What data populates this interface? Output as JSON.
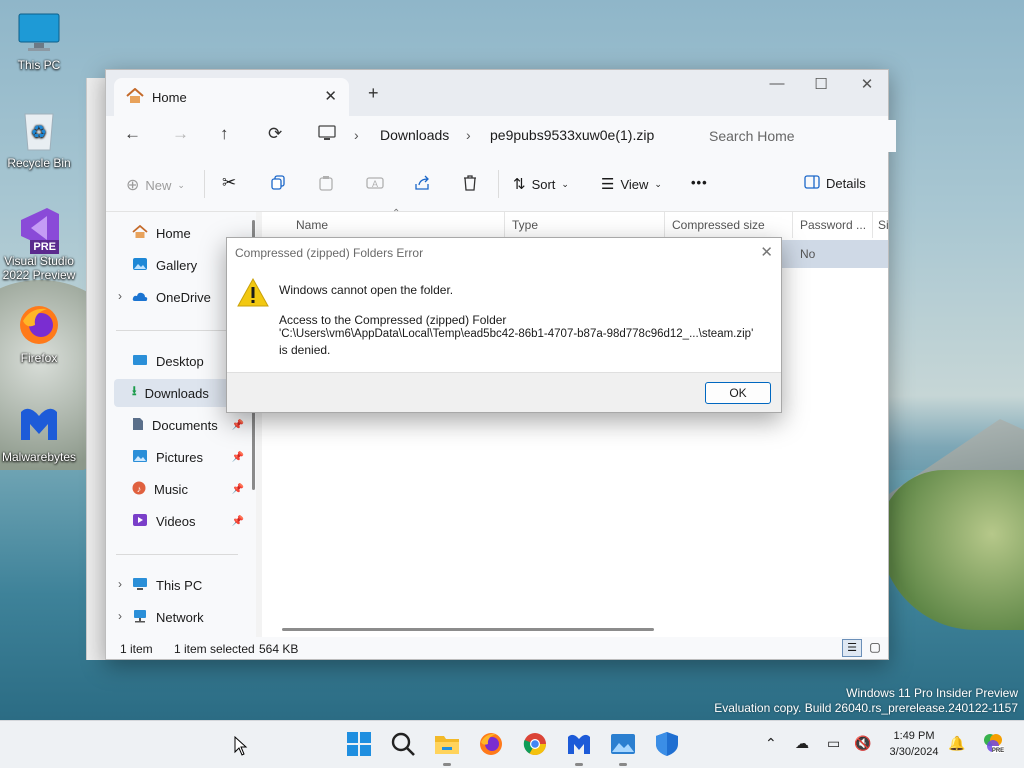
{
  "desktop": {
    "icons": [
      {
        "label": "This PC"
      },
      {
        "label": "Recycle Bin"
      },
      {
        "label": "Visual Studio 2022 Preview",
        "badge": "PRE"
      },
      {
        "label": "Firefox"
      },
      {
        "label": "Malwarebytes"
      }
    ],
    "watermark": {
      "line1": "Windows 11 Pro Insider Preview",
      "line2": "Evaluation copy. Build 26040.rs_prerelease.240122-1157"
    }
  },
  "explorer": {
    "tab_title": "Home",
    "breadcrumb": [
      "Downloads",
      "pe9pubs9533xuw0e(1).zip"
    ],
    "search_placeholder": "Search Home",
    "toolbar": {
      "new_label": "New",
      "sort_label": "Sort",
      "view_label": "View",
      "more_label": "•••",
      "details_label": "Details"
    },
    "sidebar": {
      "home": "Home",
      "gallery": "Gallery",
      "onedrive": "OneDrive",
      "desktop": "Desktop",
      "downloads": "Downloads",
      "documents": "Documents",
      "pictures": "Pictures",
      "music": "Music",
      "videos": "Videos",
      "thispc": "This PC",
      "network": "Network"
    },
    "columns": [
      "Name",
      "Type",
      "Compressed size",
      "Password ...",
      "Si"
    ],
    "row": {
      "password": "No"
    },
    "status": {
      "count": "1 item",
      "selected": "1 item selected",
      "size": "564 KB"
    }
  },
  "dialog": {
    "title": "Compressed (zipped) Folders Error",
    "message": "Windows cannot open the folder.",
    "detail1": "Access to the Compressed (zipped) Folder",
    "detail2": "'C:\\Users\\vm6\\AppData\\Local\\Temp\\ead5bc42-86b1-4707-b87a-98d778c96d12_...\\steam.zip'",
    "detail3": "is denied.",
    "ok_label": "OK"
  },
  "taskbar": {
    "time": "1:49 PM",
    "date": "3/30/2024",
    "pinned": [
      "start-icon",
      "search-icon",
      "file-explorer-icon",
      "firefox-icon",
      "chrome-icon",
      "malwarebytes-icon",
      "photos-icon",
      "defender-icon"
    ]
  },
  "colors": {
    "accent": "#0067c0",
    "warning": "#f2c811",
    "selection": "#cfd9e6"
  }
}
